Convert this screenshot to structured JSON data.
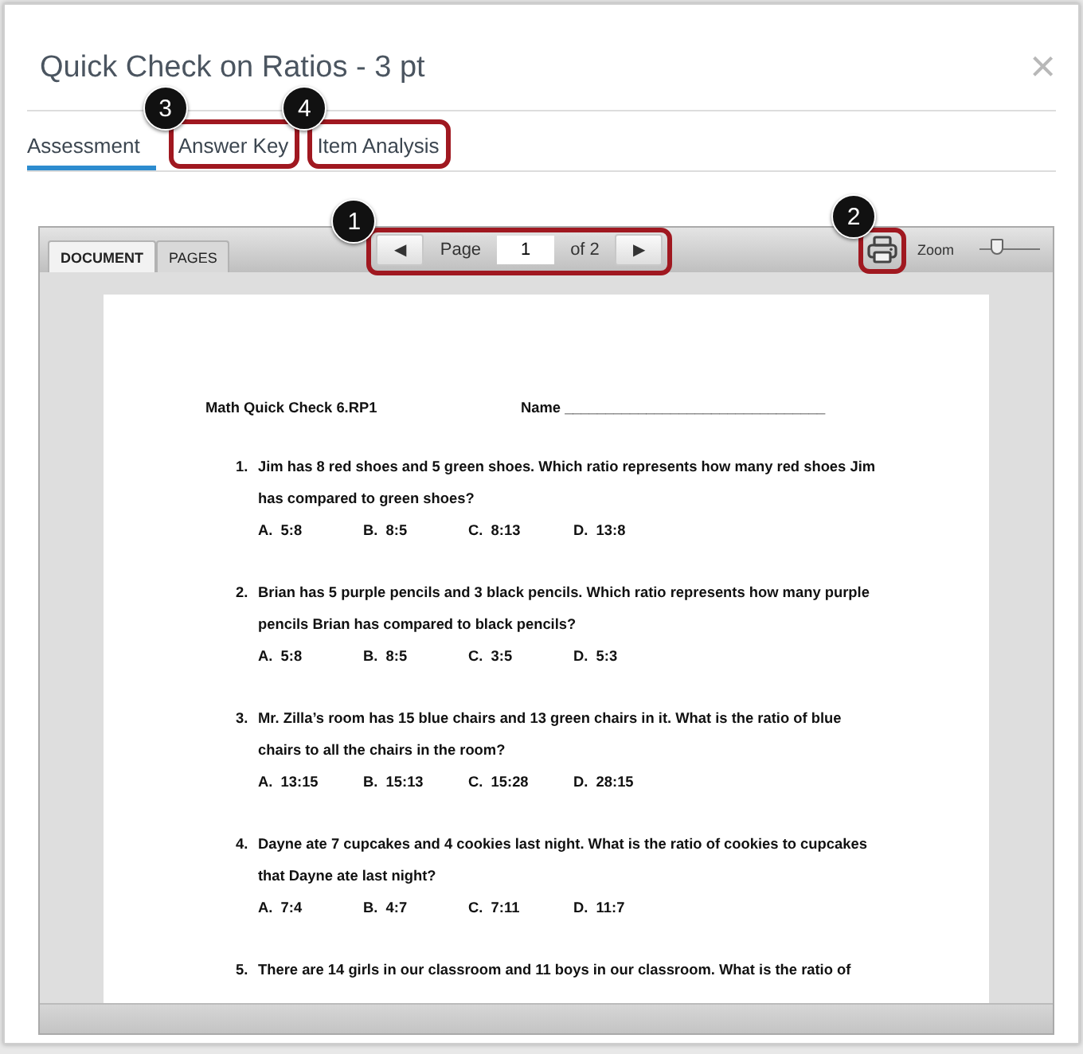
{
  "dialog": {
    "title": "Quick Check on Ratios - 3 pt",
    "close": "×"
  },
  "tabs": [
    {
      "label": "Assessment",
      "selected": true
    },
    {
      "label": "Answer Key",
      "selected": false,
      "callout": "3"
    },
    {
      "label": "Item Analysis",
      "selected": false,
      "callout": "4"
    }
  ],
  "viewer": {
    "view_tabs": [
      {
        "label": "DOCUMENT",
        "selected": true
      },
      {
        "label": "PAGES",
        "selected": false
      }
    ],
    "pager": {
      "prev": "◀",
      "label": "Page",
      "value": "1",
      "of": "of 2",
      "next": "▶",
      "callout": "1"
    },
    "print": {
      "callout": "2"
    },
    "zoom": {
      "label": "Zoom",
      "level": 0.28
    }
  },
  "document": {
    "heading": "Math Quick Check 6.RP1",
    "name_field": "Name ________________________________",
    "questions": [
      {
        "number": "1.",
        "text": "Jim has 8 red shoes and 5 green shoes. Which ratio represents how many red shoes Jim has compared to green shoes?",
        "choices": [
          "A.  5:8",
          "B.  8:5",
          "C.  8:13",
          "D.  13:8"
        ]
      },
      {
        "number": "2.",
        "text": "Brian has 5 purple pencils and 3 black pencils. Which ratio represents how many purple pencils Brian has compared to black pencils?",
        "choices": [
          "A.  5:8",
          "B.  8:5",
          "C.  3:5",
          "D.  5:3"
        ]
      },
      {
        "number": "3.",
        "text": "Mr. Zilla’s room has 15 blue chairs and 13 green chairs in it. What is the ratio of blue chairs to all the chairs in the room?",
        "choices": [
          "A.  13:15",
          "B.  15:13",
          "C.  15:28",
          "D.  28:15"
        ]
      },
      {
        "number": "4.",
        "text": "Dayne ate 7 cupcakes and 4 cookies last night. What is the ratio of cookies to cupcakes that Dayne ate last night?",
        "choices": [
          "A.  7:4",
          "B.  4:7",
          "C.  7:11",
          "D.  11:7"
        ]
      },
      {
        "number": "5.",
        "text": "There are 14 girls in our classroom and 11 boys in our classroom. What is the ratio of"
      }
    ]
  }
}
